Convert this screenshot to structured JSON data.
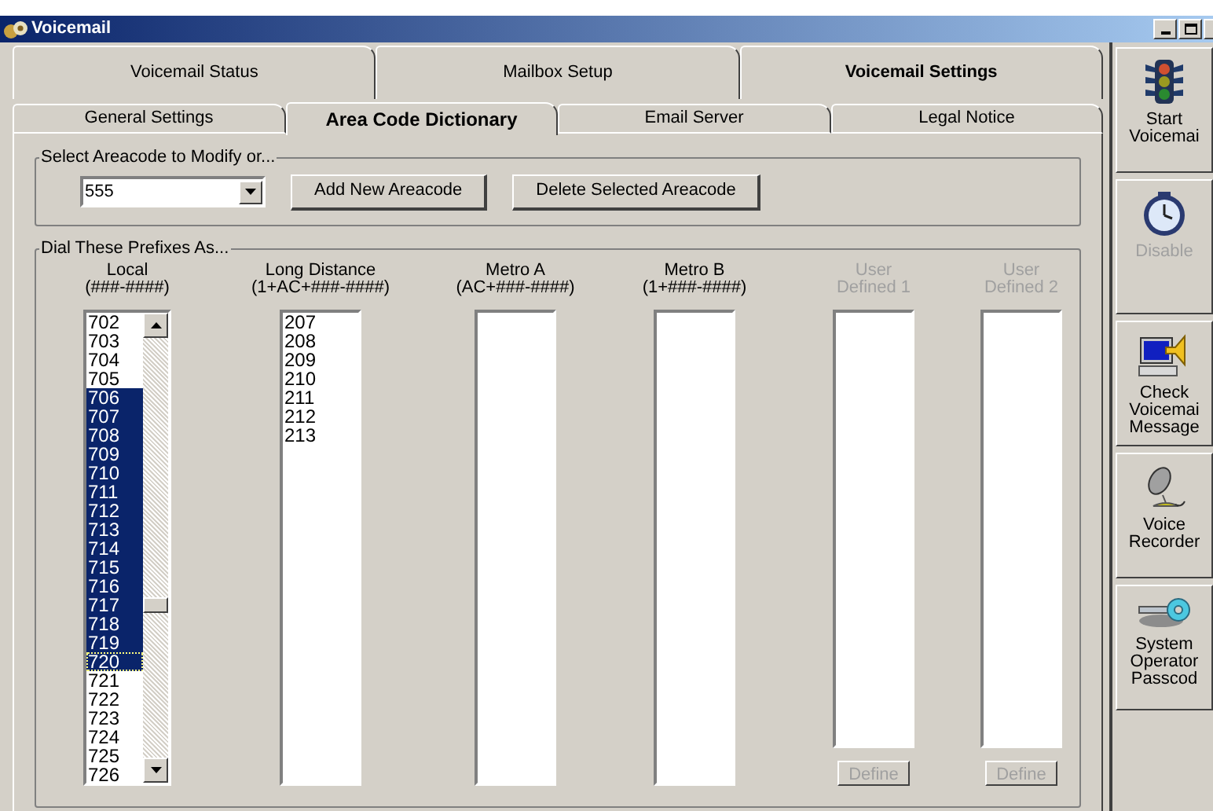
{
  "window": {
    "title": "Voicemail"
  },
  "main_tabs": [
    {
      "label": "Voicemail Status",
      "selected": false
    },
    {
      "label": "Mailbox Setup",
      "selected": false
    },
    {
      "label": "Voicemail Settings",
      "selected": true
    }
  ],
  "sub_tabs": [
    {
      "label": "General Settings",
      "selected": false
    },
    {
      "label": "Area Code Dictionary",
      "selected": true
    },
    {
      "label": "Email Server",
      "selected": false
    },
    {
      "label": "Legal Notice",
      "selected": false
    }
  ],
  "areacode_group": {
    "title": "Select Areacode to Modify or...",
    "areacode": "555",
    "buttons": [
      "Add New Areacode",
      "Delete Selected Areacode"
    ]
  },
  "prefix_group": {
    "title": "Dial These Prefixes As...",
    "columns": [
      {
        "name": "Local",
        "format": "(###-####)",
        "disabled": false,
        "scrollbar": true,
        "items": [
          {
            "text": "702",
            "selected": false,
            "focused": false
          },
          {
            "text": "703",
            "selected": false,
            "focused": false
          },
          {
            "text": "704",
            "selected": false,
            "focused": false
          },
          {
            "text": "705",
            "selected": false,
            "focused": false
          },
          {
            "text": "706",
            "selected": true,
            "focused": false
          },
          {
            "text": "707",
            "selected": true,
            "focused": false
          },
          {
            "text": "708",
            "selected": true,
            "focused": false
          },
          {
            "text": "709",
            "selected": true,
            "focused": false
          },
          {
            "text": "710",
            "selected": true,
            "focused": false
          },
          {
            "text": "711",
            "selected": true,
            "focused": false
          },
          {
            "text": "712",
            "selected": true,
            "focused": false
          },
          {
            "text": "713",
            "selected": true,
            "focused": false
          },
          {
            "text": "714",
            "selected": true,
            "focused": false
          },
          {
            "text": "715",
            "selected": true,
            "focused": false
          },
          {
            "text": "716",
            "selected": true,
            "focused": false
          },
          {
            "text": "717",
            "selected": true,
            "focused": false
          },
          {
            "text": "718",
            "selected": true,
            "focused": false
          },
          {
            "text": "719",
            "selected": true,
            "focused": false
          },
          {
            "text": "720",
            "selected": true,
            "focused": true
          },
          {
            "text": "721",
            "selected": false,
            "focused": false
          },
          {
            "text": "722",
            "selected": false,
            "focused": false
          },
          {
            "text": "723",
            "selected": false,
            "focused": false
          },
          {
            "text": "724",
            "selected": false,
            "focused": false
          },
          {
            "text": "725",
            "selected": false,
            "focused": false
          },
          {
            "text": "726",
            "selected": false,
            "focused": false
          }
        ]
      },
      {
        "name": "Long Distance",
        "format": "(1+AC+###-####)",
        "disabled": false,
        "scrollbar": false,
        "items": [
          {
            "text": "207",
            "selected": false,
            "focused": false
          },
          {
            "text": "208",
            "selected": false,
            "focused": false
          },
          {
            "text": "209",
            "selected": false,
            "focused": false
          },
          {
            "text": "210",
            "selected": false,
            "focused": false
          },
          {
            "text": "211",
            "selected": false,
            "focused": false
          },
          {
            "text": "212",
            "selected": false,
            "focused": false
          },
          {
            "text": "213",
            "selected": false,
            "focused": false
          }
        ]
      },
      {
        "name": "Metro A",
        "format": "(AC+###-####)",
        "disabled": false,
        "scrollbar": false
      },
      {
        "name": "Metro B",
        "format": "(1+###-####)",
        "disabled": false,
        "scrollbar": false
      },
      {
        "name": "User",
        "format": "Defined 1",
        "disabled": true,
        "scrollbar": false,
        "define_button": "Define"
      },
      {
        "name": "User",
        "format": "Defined 2",
        "disabled": true,
        "scrollbar": false,
        "define_button": "Define"
      }
    ]
  },
  "sidebar_buttons": [
    {
      "kind": "traffic-light",
      "lines": [
        "Start",
        "Voicemai"
      ],
      "disabled": false
    },
    {
      "kind": "clock",
      "lines": [
        "Disable"
      ],
      "disabled": true
    },
    {
      "kind": "computer",
      "lines": [
        "Check",
        "Voicemai",
        "Message"
      ],
      "disabled": false
    },
    {
      "kind": "microphone",
      "lines": [
        "Voice",
        "Recorder"
      ],
      "disabled": false
    },
    {
      "kind": "key",
      "lines": [
        "System",
        "Operator",
        "Passcod"
      ],
      "disabled": false
    }
  ]
}
